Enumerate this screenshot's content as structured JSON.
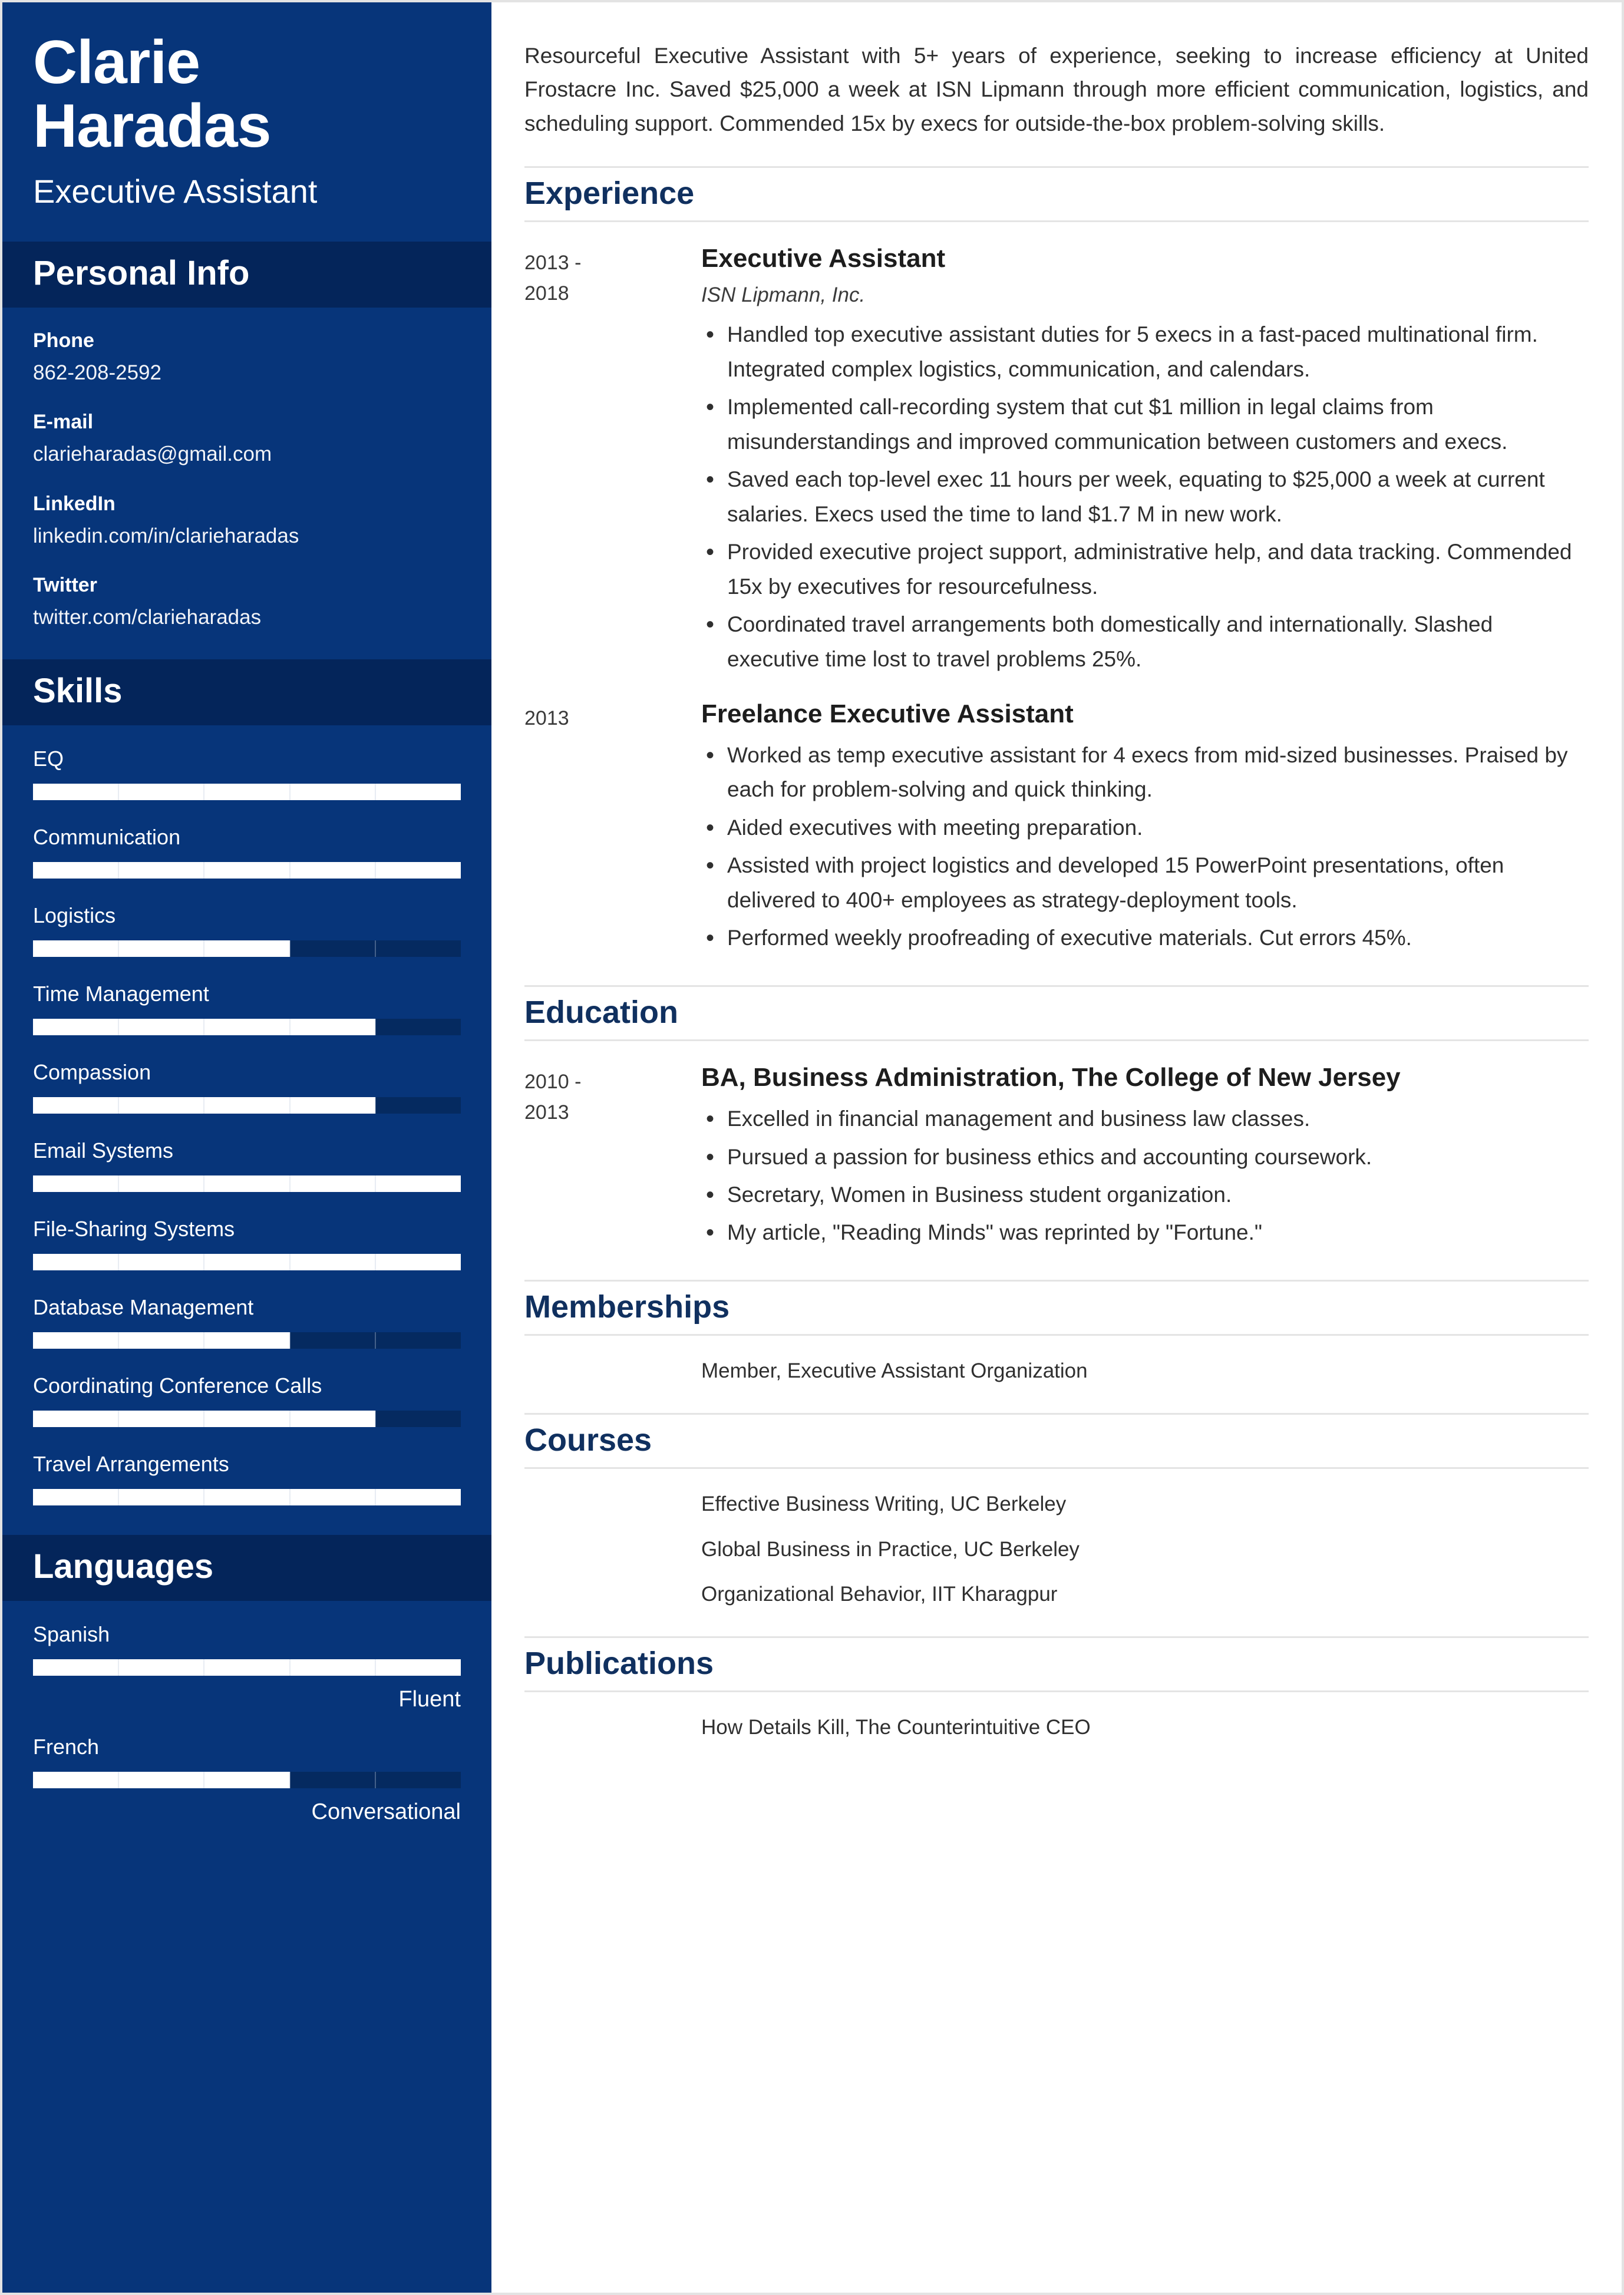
{
  "theme": {
    "sidebar_blue": "#07357a",
    "band_navy": "#04255a",
    "heading_navy": "#10305f",
    "bar_track": "#052a60",
    "bar_fill": "#ffffff",
    "divider": "#e4e4e4"
  },
  "sidebar": {
    "name_line1": "Clarie",
    "name_line2": "Haradas",
    "job_title": "Executive Assistant",
    "personal_info": {
      "heading": "Personal Info",
      "items": [
        {
          "label": "Phone",
          "value": "862-208-2592"
        },
        {
          "label": "E-mail",
          "value": "clarieharadas@gmail.com"
        },
        {
          "label": "LinkedIn",
          "value": "linkedin.com/in/clarieharadas"
        },
        {
          "label": "Twitter",
          "value": "twitter.com/clarieharadas"
        }
      ]
    },
    "skills": {
      "heading": "Skills",
      "items": [
        {
          "label": "EQ",
          "level": 100
        },
        {
          "label": "Communication",
          "level": 100
        },
        {
          "label": "Logistics",
          "level": 60
        },
        {
          "label": "Time Management",
          "level": 80
        },
        {
          "label": "Compassion",
          "level": 80
        },
        {
          "label": "Email Systems",
          "level": 100
        },
        {
          "label": "File-Sharing Systems",
          "level": 100
        },
        {
          "label": "Database Management",
          "level": 60
        },
        {
          "label": "Coordinating Conference Calls",
          "level": 80
        },
        {
          "label": "Travel Arrangements",
          "level": 100
        }
      ]
    },
    "languages": {
      "heading": "Languages",
      "items": [
        {
          "label": "Spanish",
          "level": 100,
          "proficiency": "Fluent"
        },
        {
          "label": "French",
          "level": 60,
          "proficiency": "Conversational"
        }
      ]
    }
  },
  "main": {
    "summary": "Resourceful Executive Assistant with 5+ years of experience, seeking to increase efficiency at United Frostacre Inc. Saved $25,000 a week at ISN Lipmann through more efficient communication, logistics, and scheduling support. Commended 15x by execs for outside-the-box problem-solving skills.",
    "experience": {
      "heading": "Experience",
      "entries": [
        {
          "date_line1": "2013 -",
          "date_line2": "2018",
          "title": "Executive Assistant",
          "org": "ISN Lipmann, Inc.",
          "bullets": [
            "Handled top executive assistant duties for 5 execs in a fast-paced multinational firm. Integrated complex logistics, communication, and calendars.",
            "Implemented call-recording system that cut $1 million in legal claims from misunderstandings and improved communication between customers and execs.",
            "Saved each top-level exec 11 hours per week, equating to $25,000 a week at current salaries. Execs used the time to land $1.7 M in new work.",
            "Provided executive project support, administrative help, and data tracking. Commended 15x by executives for resourcefulness.",
            "Coordinated travel arrangements both domestically and internationally. Slashed executive time lost to travel problems 25%."
          ]
        },
        {
          "date_line1": "2013",
          "date_line2": "",
          "title": "Freelance Executive Assistant",
          "org": "",
          "bullets": [
            "Worked as temp executive assistant for 4 execs from mid-sized businesses. Praised by each for problem-solving and quick thinking.",
            "Aided executives with meeting preparation.",
            "Assisted with project logistics and developed 15 PowerPoint presentations, often delivered to 400+ employees as strategy-deployment tools.",
            "Performed weekly proofreading of executive materials. Cut errors 45%."
          ]
        }
      ]
    },
    "education": {
      "heading": "Education",
      "entries": [
        {
          "date_line1": "2010 -",
          "date_line2": "2013",
          "title": "BA, Business Administration, The College of New Jersey",
          "org": "",
          "bullets": [
            "Excelled in financial management and business law classes.",
            "Pursued a passion for business ethics and accounting coursework.",
            "Secretary, Women in Business student organization.",
            "My article, \"Reading Minds\" was reprinted by \"Fortune.\""
          ]
        }
      ]
    },
    "memberships": {
      "heading": "Memberships",
      "items": [
        "Member, Executive Assistant Organization"
      ]
    },
    "courses": {
      "heading": "Courses",
      "items": [
        "Effective Business Writing, UC Berkeley",
        "Global Business in Practice, UC Berkeley",
        "Organizational Behavior, IIT Kharagpur"
      ]
    },
    "publications": {
      "heading": "Publications",
      "items": [
        "How Details Kill, The Counterintuitive CEO"
      ]
    }
  }
}
